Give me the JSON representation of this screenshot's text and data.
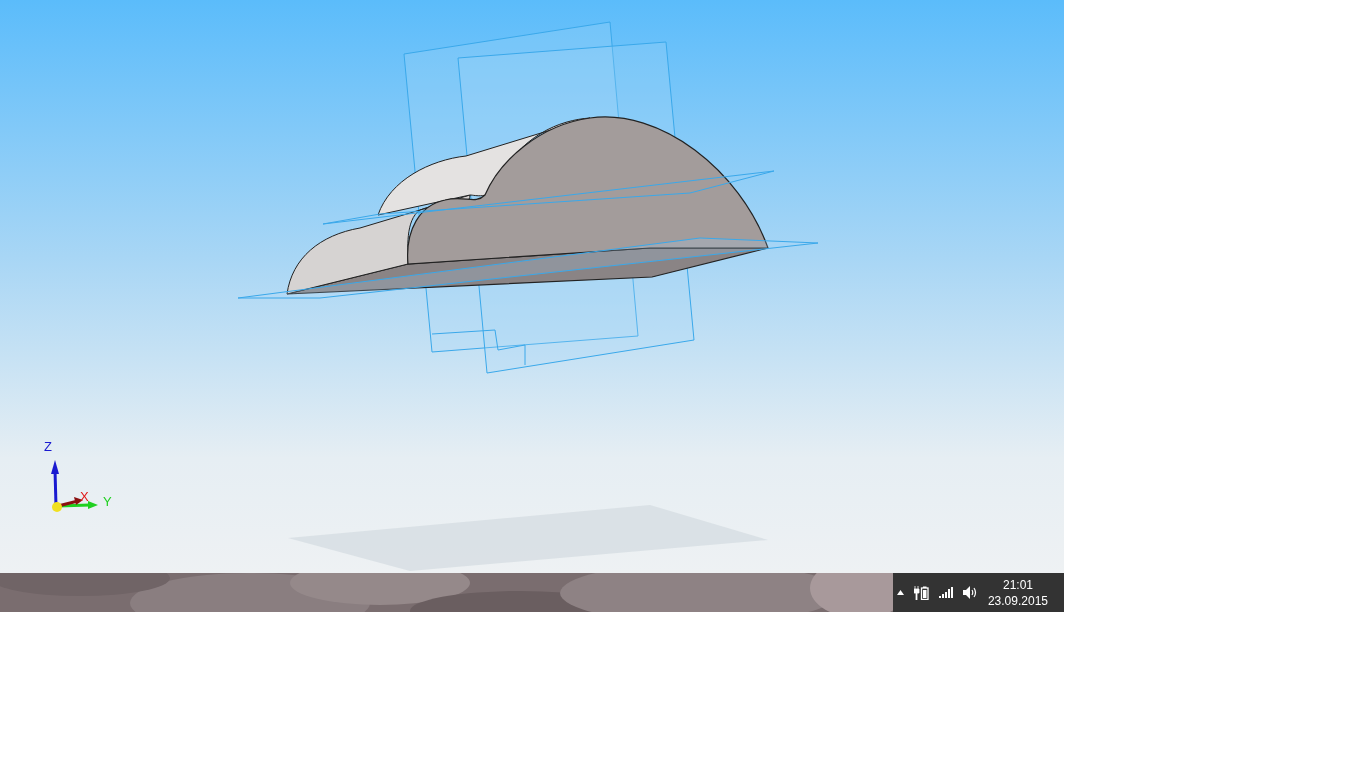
{
  "viewport": {
    "axes": [
      {
        "kind": "z",
        "label": "Z",
        "color": "#1a1ad0"
      },
      {
        "kind": "x",
        "label": "X",
        "color": "#e01818"
      },
      {
        "kind": "y",
        "label": "Y",
        "color": "#20d020"
      }
    ]
  },
  "taskbar": {
    "clock": {
      "time": "21:01",
      "date": "23.09.2015"
    }
  }
}
